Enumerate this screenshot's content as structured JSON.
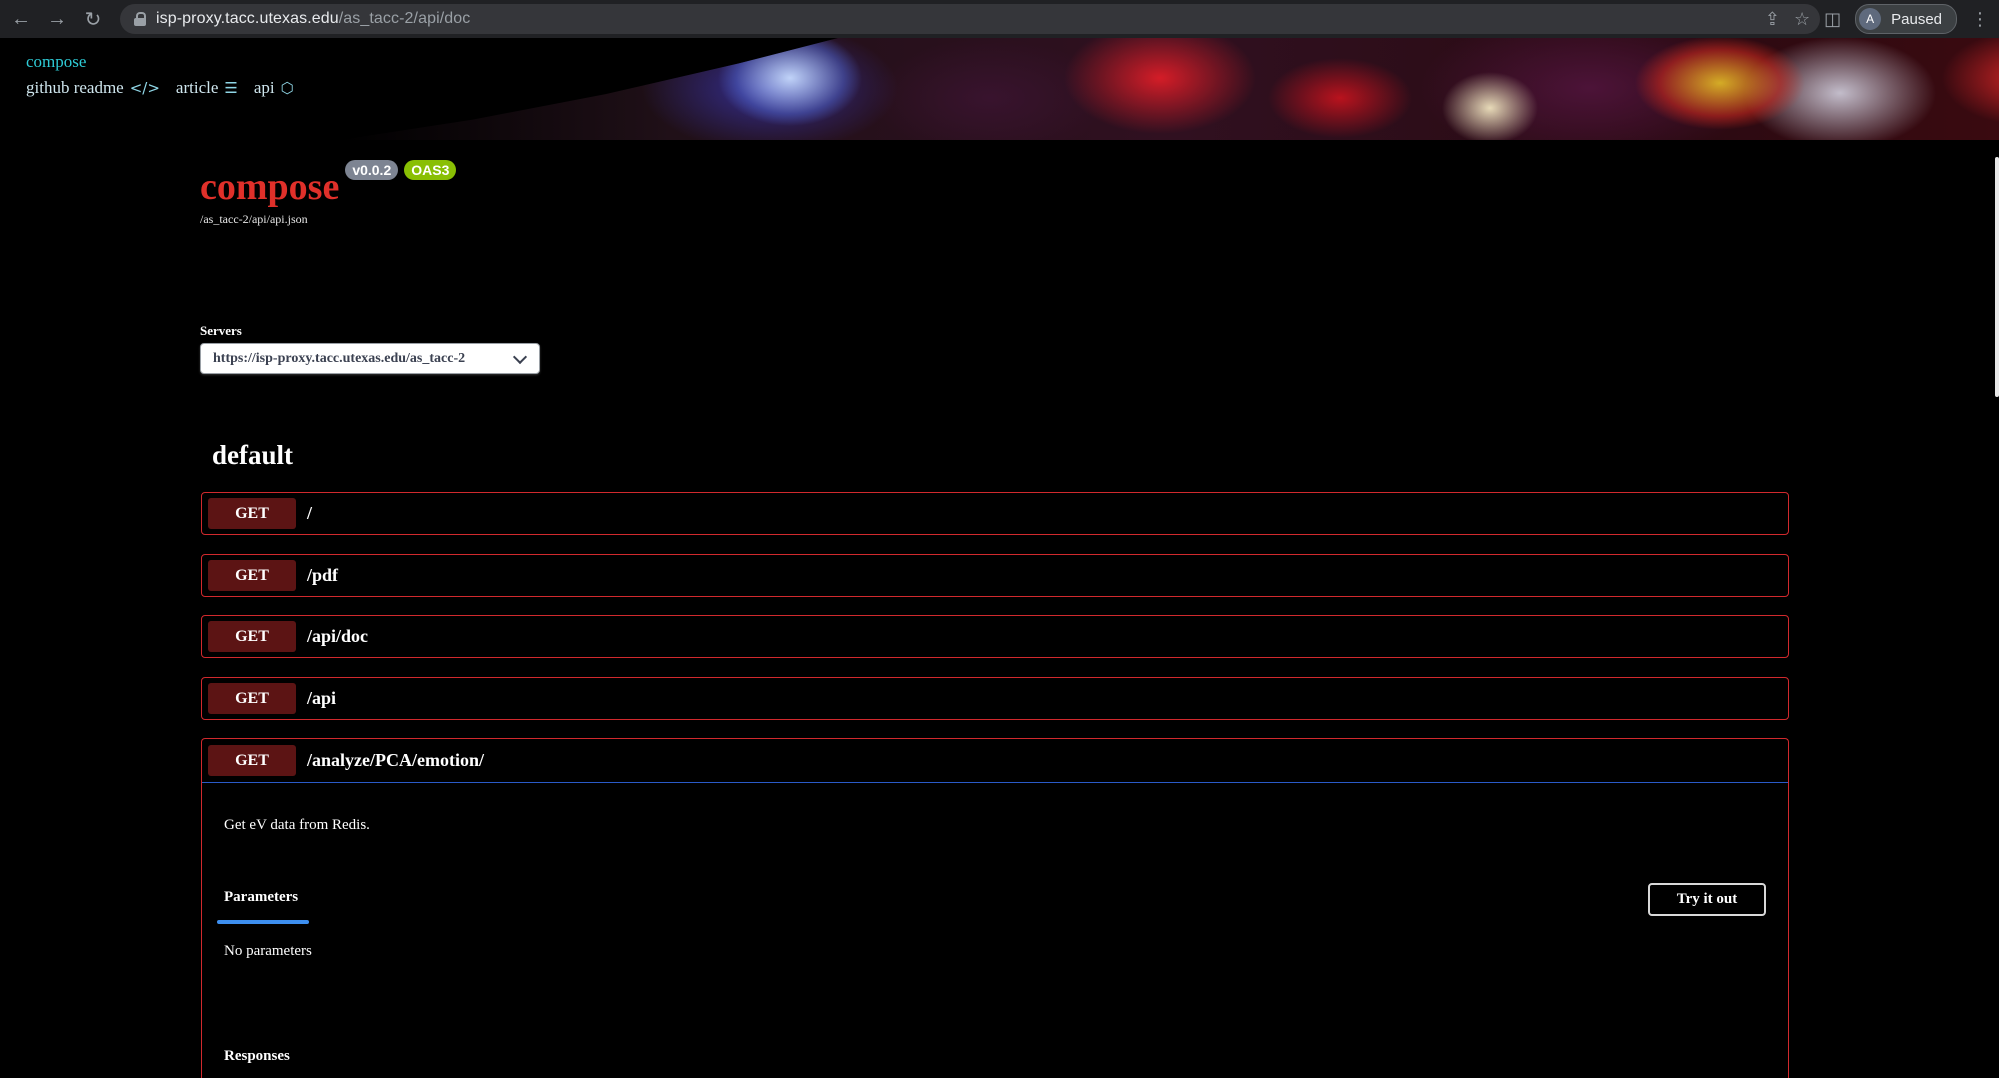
{
  "browser": {
    "url_host": "isp-proxy.tacc.utexas.edu",
    "url_path": "/as_tacc-2/api/doc",
    "profile_initial": "A",
    "profile_status": "Paused"
  },
  "banner": {
    "brand": "compose",
    "links": [
      {
        "label": "github readme",
        "icon": "code-icon"
      },
      {
        "label": "article",
        "icon": "list-icon"
      },
      {
        "label": "api",
        "icon": "hexagon-icon"
      }
    ]
  },
  "info": {
    "title": "compose",
    "version_badge": "v0.0.2",
    "oas_badge": "OAS3",
    "spec_url": "/as_tacc-2/api/api.json"
  },
  "servers": {
    "label": "Servers",
    "selected": "https://isp-proxy.tacc.utexas.edu/as_tacc-2"
  },
  "tag": {
    "title": "default"
  },
  "operations": [
    {
      "method": "GET",
      "path": "/"
    },
    {
      "method": "GET",
      "path": "/pdf"
    },
    {
      "method": "GET",
      "path": "/api/doc"
    },
    {
      "method": "GET",
      "path": "/api"
    },
    {
      "method": "GET",
      "path": "/analyze/PCA/emotion/"
    }
  ],
  "expanded": {
    "description": "Get eV data from Redis.",
    "params_tab": "Parameters",
    "try_label": "Try it out",
    "no_params": "No parameters",
    "responses_label": "Responses"
  },
  "colors": {
    "accent_red": "#d1292d",
    "method_bg": "#5c1414",
    "oas_green": "#89bf04",
    "tab_blue": "#3d8ff0"
  }
}
